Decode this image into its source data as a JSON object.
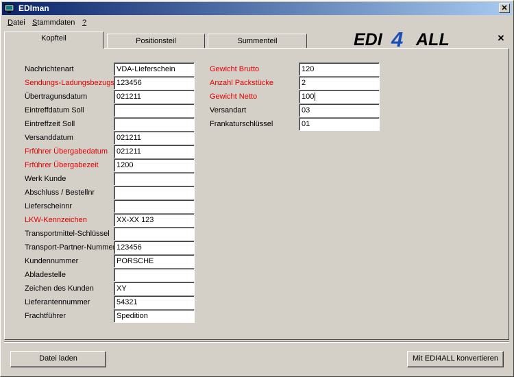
{
  "window": {
    "title": "EDIman"
  },
  "menu": [
    {
      "label": "Datei",
      "underline": "D",
      "rest": "atei"
    },
    {
      "label": "Stammdaten",
      "underline": "S",
      "rest": "tammdaten"
    },
    {
      "label": "?",
      "underline": "?",
      "rest": ""
    }
  ],
  "tabs": [
    {
      "label": "Kopfteil",
      "active": true
    },
    {
      "label": "Positionsteil",
      "active": false
    },
    {
      "label": "Summenteil",
      "active": false
    }
  ],
  "logo": {
    "part1": "EDI",
    "part2": "4",
    "part3": "ALL"
  },
  "left_fields": [
    {
      "label": "Nachrichtenart",
      "value": "VDA-Lieferschein",
      "required": false
    },
    {
      "label": "Sendungs-Ladungsbezugsnr",
      "value": "123456",
      "required": true
    },
    {
      "label": "Übertragunsdatum",
      "value": "021211",
      "required": false
    },
    {
      "label": "Eintreffdatum Soll",
      "value": "",
      "required": false
    },
    {
      "label": "Eintreffzeit Soll",
      "value": "",
      "required": false
    },
    {
      "label": "Versanddatum",
      "value": "021211",
      "required": false
    },
    {
      "label": "Frführer Übergabedatum",
      "value": "021211",
      "required": true
    },
    {
      "label": "Frführer Übergabezeit",
      "value": "1200",
      "required": true
    },
    {
      "label": "Werk Kunde",
      "value": "",
      "required": false
    },
    {
      "label": "Abschluss / Bestellnr",
      "value": "",
      "required": false
    },
    {
      "label": "Lieferscheinnr",
      "value": "",
      "required": false
    },
    {
      "label": "LKW-Kennzeichen",
      "value": "XX-XX 123",
      "required": true
    },
    {
      "label": "Transportmittel-Schlüssel",
      "value": "",
      "required": false
    },
    {
      "label": "Transport-Partner-Nummer",
      "value": "123456",
      "required": false
    },
    {
      "label": "Kundennummer",
      "value": "PORSCHE",
      "required": false
    },
    {
      "label": "Abladestelle",
      "value": "",
      "required": false
    },
    {
      "label": "Zeichen des Kunden",
      "value": "XY",
      "required": false
    },
    {
      "label": "Lieferantennummer",
      "value": "54321",
      "required": false
    },
    {
      "label": "Frachtführer",
      "value": "Spedition",
      "required": false
    }
  ],
  "right_fields": [
    {
      "label": "Gewicht Brutto",
      "value": "120",
      "required": true
    },
    {
      "label": "Anzahl Packstücke",
      "value": "2",
      "required": true
    },
    {
      "label": "Gewicht Netto",
      "value": "100",
      "required": true
    },
    {
      "label": "Versandart",
      "value": "03",
      "required": false
    },
    {
      "label": "Frankaturschlüssel",
      "value": "01",
      "required": false
    }
  ],
  "buttons": {
    "load": "Datei laden",
    "convert": "Mit EDI4ALL konvertieren"
  },
  "colors": {
    "required": "#e00000",
    "title_start": "#0a246a",
    "title_end": "#a6caf0",
    "face": "#d4d0c8"
  }
}
